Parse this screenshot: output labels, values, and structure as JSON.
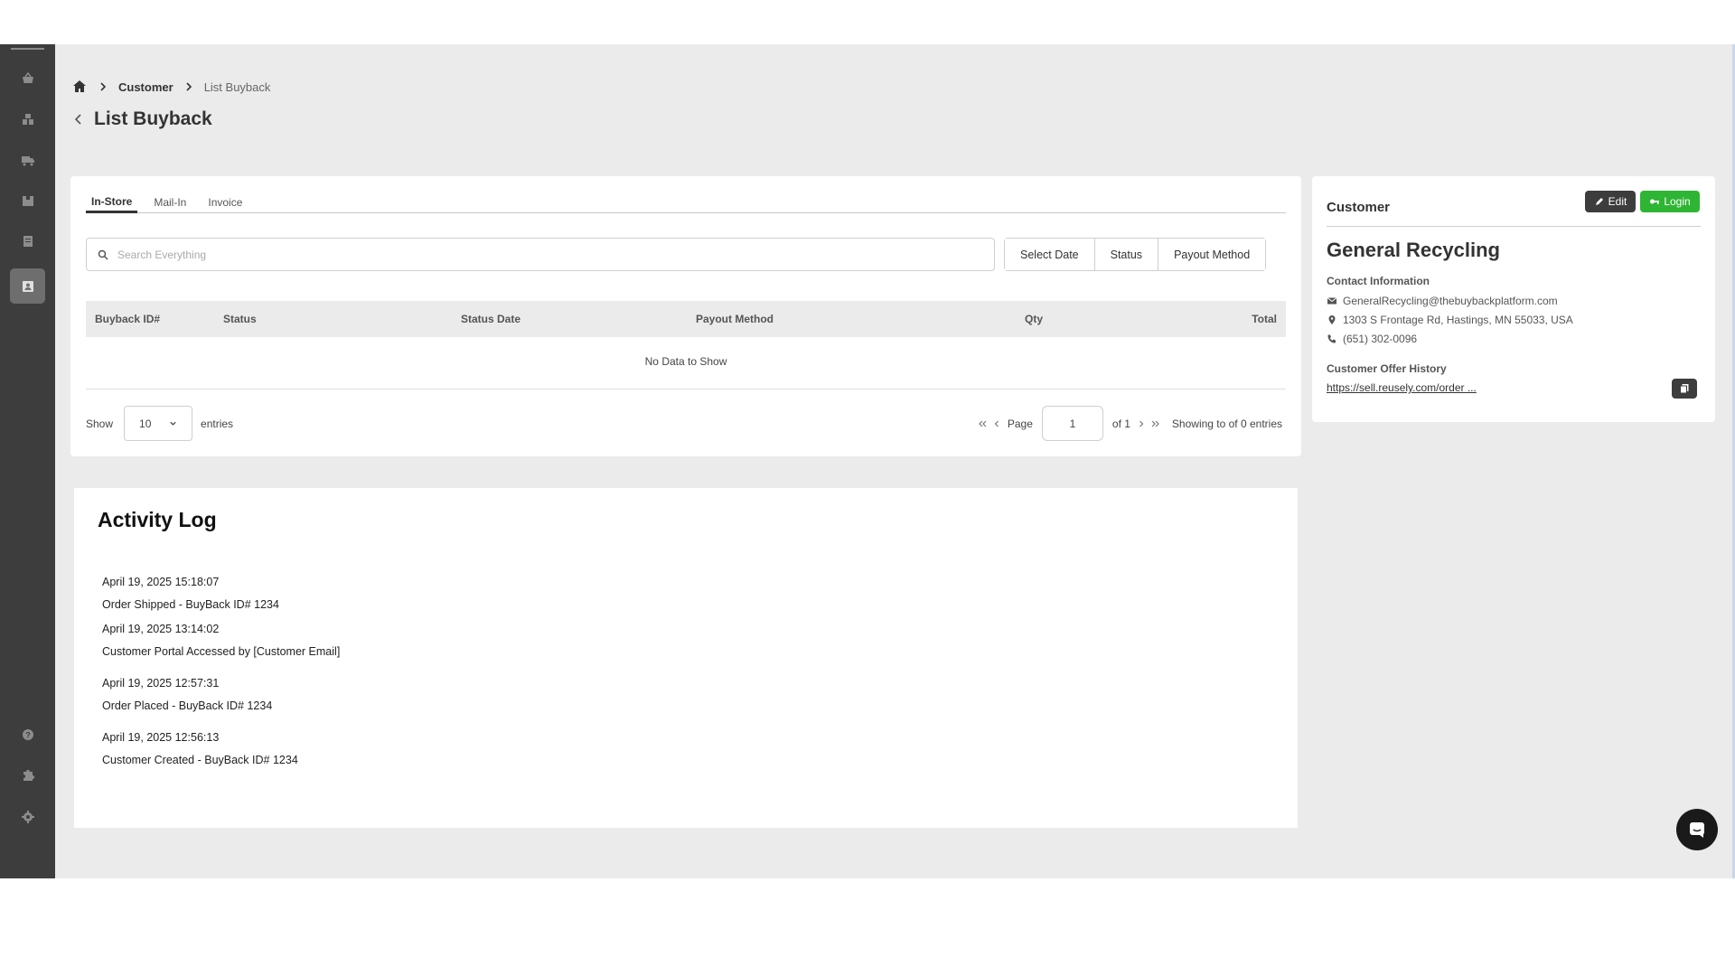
{
  "sidebar": {
    "items": [
      {
        "icon": "basket-icon"
      },
      {
        "icon": "boxes-icon"
      },
      {
        "icon": "truck-icon"
      },
      {
        "icon": "box-icon"
      },
      {
        "icon": "document-icon"
      },
      {
        "icon": "contact-card-icon",
        "active": true
      }
    ],
    "bottom_items": [
      {
        "icon": "help-icon"
      },
      {
        "icon": "puzzle-icon"
      },
      {
        "icon": "gear-icon"
      }
    ]
  },
  "breadcrumb": {
    "items": [
      "Customer",
      "List Buyback"
    ]
  },
  "page": {
    "title": "List Buyback"
  },
  "tabs": [
    "In-Store",
    "Mail-In",
    "Invoice"
  ],
  "search": {
    "placeholder": "Search Everything",
    "value": ""
  },
  "filters": [
    "Select Date",
    "Status",
    "Payout Method"
  ],
  "table": {
    "columns": [
      "Buyback ID#",
      "Status",
      "Status Date",
      "Payout Method",
      "Qty",
      "Total"
    ],
    "rows": [],
    "empty_text": "No Data to Show"
  },
  "pagination": {
    "show_label": "Show",
    "entries_value": "10",
    "entries_label": "entries",
    "page_label": "Page",
    "page_value": "1",
    "of_label": "of 1",
    "showing_text": "Showing to of 0 entries"
  },
  "customer": {
    "header": "Customer",
    "edit_label": "Edit",
    "login_label": "Login",
    "name": "General Recycling",
    "contact_label": "Contact Information",
    "email": "GeneralRecycling@thebuybackplatform.com",
    "address": "1303 S Frontage Rd, Hastings, MN 55033, USA",
    "phone": "(651) 302-0096",
    "offer_history_label": "Customer Offer History",
    "offer_link": "https://sell.reusely.com/order ..."
  },
  "activity": {
    "title": "Activity Log",
    "entries": [
      {
        "time": "April 19, 2025 15:18:07",
        "text": "Order Shipped - BuyBack ID# 1234"
      },
      {
        "time": "April 19, 2025 13:14:02",
        "text": "Customer Portal Accessed by [Customer Email]"
      },
      {
        "time": "April 19, 2025 12:57:31",
        "text": "Order Placed - BuyBack ID# 1234"
      },
      {
        "time": "April 19, 2025 12:56:13",
        "text": "Customer Created - BuyBack ID# 1234"
      }
    ]
  },
  "colors": {
    "sidebar": "#3d3d3d",
    "background": "#ebebeb",
    "edit_button": "#3d3d3d",
    "login_button": "#2fb534"
  }
}
